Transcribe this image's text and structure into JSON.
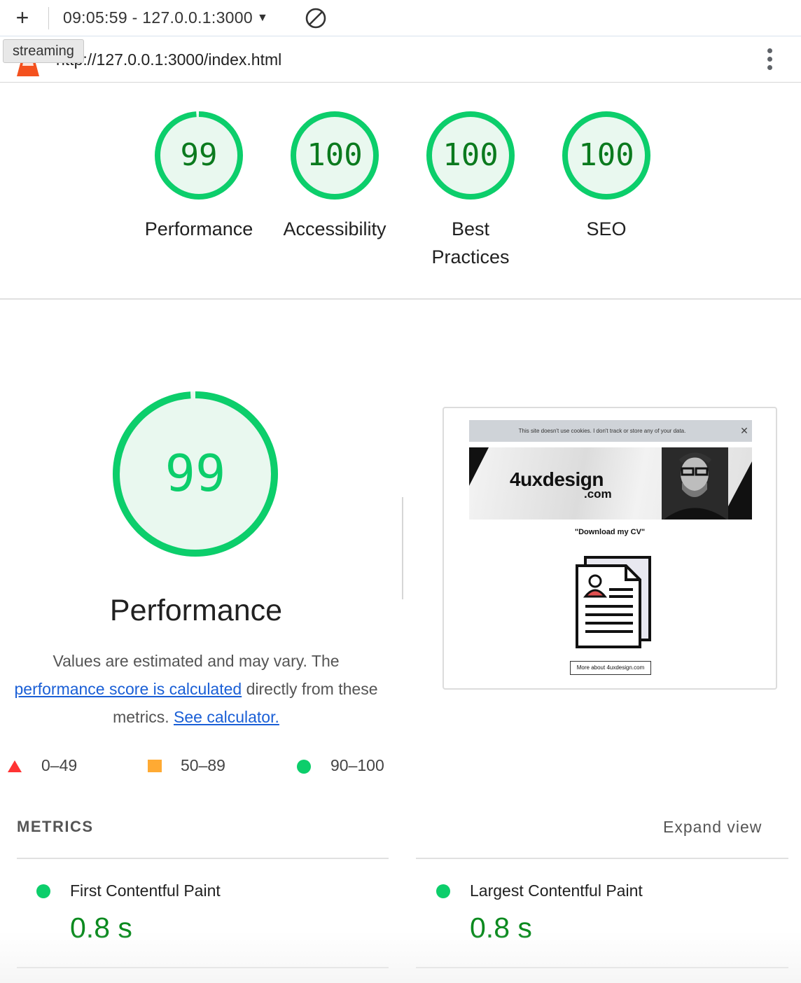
{
  "toolbar": {
    "new_label": "+",
    "session_title": "09:05:59 - 127.0.0.1:3000",
    "dropdown_caret": "▼",
    "tooltip": "streaming"
  },
  "urlbar": {
    "url": "http://127.0.0.1:3000/index.html",
    "logo_icon": "lighthouse-icon",
    "menu_icon": "kebab-menu-icon"
  },
  "scores": [
    {
      "value": "99",
      "label": "Performance",
      "fraction": 0.99
    },
    {
      "value": "100",
      "label": "Accessibility",
      "fraction": 1.0
    },
    {
      "value": "100",
      "label": "Best Practices",
      "fraction": 1.0
    },
    {
      "value": "100",
      "label": "SEO",
      "fraction": 1.0
    }
  ],
  "performance": {
    "score": "99",
    "fraction": 0.99,
    "title": "Performance",
    "desc_part1": "Values are estimated and may vary. The ",
    "desc_link1": "performance score is calculated",
    "desc_part2": " directly from these metrics. ",
    "desc_link2": "See calculator."
  },
  "legend": {
    "fail": "0–49",
    "average": "50–89",
    "pass": "90–100"
  },
  "preview": {
    "cookie_text": "This site doesn't use cookies. I don't track or store any of your data.",
    "close": "✕",
    "logo_main": "4uxdesign",
    "logo_sub": ".com",
    "download_text": "\"Download my CV\"",
    "button_text": "More about 4uxdesign.com"
  },
  "metrics": {
    "heading": "METRICS",
    "expand": "Expand view",
    "items": [
      {
        "name": "First Contentful Paint",
        "value": "0.8 s"
      },
      {
        "name": "Largest Contentful Paint",
        "value": "0.8 s"
      }
    ]
  },
  "colors": {
    "pass": "#0cce6b",
    "pass_text": "#0b7a1e",
    "average": "#ffaa33",
    "fail": "#ff3333",
    "link": "#1a5fd6"
  }
}
